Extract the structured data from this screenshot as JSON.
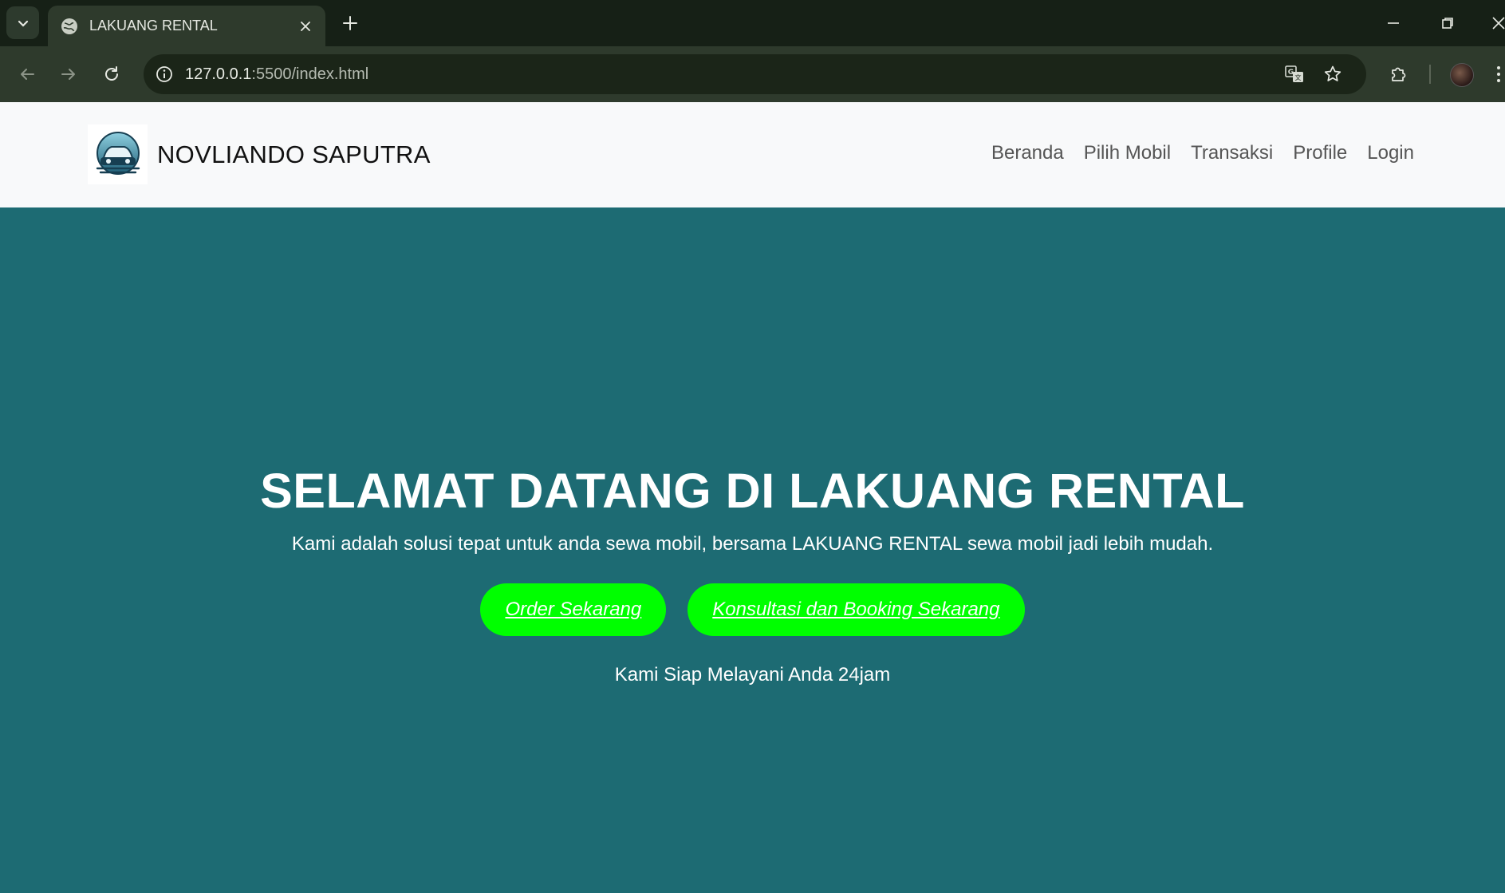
{
  "browser": {
    "tab_title": "LAKUANG RENTAL",
    "url_host": "127.0.0.1",
    "url_rest": ":5500/index.html"
  },
  "navbar": {
    "brand_name": "NOVLIANDO SAPUTRA",
    "links": [
      "Beranda",
      "Pilih Mobil",
      "Transaksi",
      "Profile",
      "Login"
    ]
  },
  "hero": {
    "title": "SELAMAT DATANG DI LAKUANG RENTAL",
    "lead": "Kami adalah solusi tepat untuk anda sewa mobil, bersama LAKUANG RENTAL sewa mobil jadi lebih mudah.",
    "order_button": "Order Sekarang",
    "consult_button": "Konsultasi dan Booking Sekarang",
    "note": "Kami Siap Melayani Anda 24jam"
  },
  "colors": {
    "hero_background": "#1d6b73",
    "navbar_background": "#f8f9fa",
    "button_green": "#00ff00",
    "browser_frame": "#162016"
  }
}
